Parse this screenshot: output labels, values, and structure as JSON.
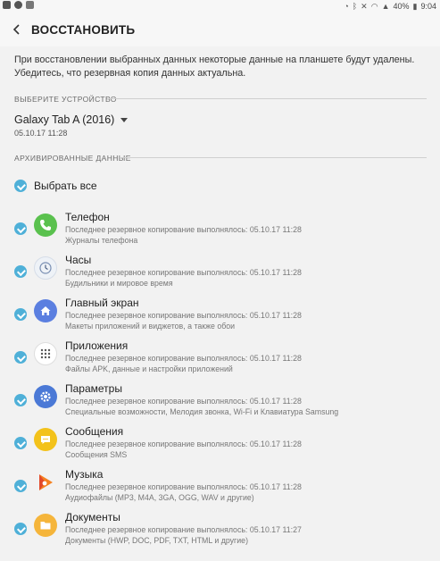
{
  "status": {
    "left_icons": [
      "mail-icon",
      "app-icon",
      "download-icon"
    ],
    "battery": "40%",
    "time": "9:04",
    "right_icons": [
      "sync-icon",
      "bluetooth-icon",
      "mute-icon",
      "wifi-icon",
      "signal-icon",
      "battery-icon"
    ]
  },
  "header": {
    "title": "ВОССТАНОВИТЬ"
  },
  "notice": "При восстановлении выбранных данных некоторые данные на планшете будут удалены. Убедитесь, что резервная копия данных актуальна.",
  "device_section": {
    "heading": "ВЫБЕРИТЕ УСТРОЙСТВО",
    "device_name": "Galaxy Tab A (2016)",
    "device_date": "05.10.17 11:28"
  },
  "data_section": {
    "heading": "АРХИВИРОВАННЫЕ ДАННЫЕ",
    "select_all": "Выбрать все",
    "items": [
      {
        "name": "Телефон",
        "line1": "Последнее резервное копирование выполнялось: 05.10.17 11:28",
        "line2": "Журналы телефона",
        "icon": "phone-icon",
        "color": "#5ac14e"
      },
      {
        "name": "Часы",
        "line1": "Последнее резервное копирование выполнялось: 05.10.17 11:28",
        "line2": "Будильники и мировое время",
        "icon": "clock-icon",
        "color": "#eef2f7"
      },
      {
        "name": "Главный экран",
        "line1": "Последнее резервное копирование выполнялось: 05.10.17 11:28",
        "line2": "Макеты приложений и виджетов, а также обои",
        "icon": "home-icon",
        "color": "#5b7fe0"
      },
      {
        "name": "Приложения",
        "line1": "Последнее резервное копирование выполнялось: 05.10.17 11:28",
        "line2": "Файлы APK, данные и настройки приложений",
        "icon": "apps-icon",
        "color": "#ffffff"
      },
      {
        "name": "Параметры",
        "line1": "Последнее резервное копирование выполнялось: 05.10.17 11:28",
        "line2": "Специальные возможности, Мелодия звонка, Wi-Fi и Клавиатура Samsung",
        "icon": "settings-icon",
        "color": "#4b79d6"
      },
      {
        "name": "Сообщения",
        "line1": "Последнее резервное копирование выполнялось: 05.10.17 11:28",
        "line2": "Сообщения SMS",
        "icon": "messages-icon",
        "color": "#f3c21b"
      },
      {
        "name": "Музыка",
        "line1": "Последнее резервное копирование выполнялось: 05.10.17 11:28",
        "line2": "Аудиофайлы (MP3, M4A, 3GA, OGG, WAV и другие)",
        "icon": "music-icon",
        "color": "#f58220"
      },
      {
        "name": "Документы",
        "line1": "Последнее резервное копирование выполнялось: 05.10.17 11:27",
        "line2": "Документы (HWP, DOC, PDF, TXT, HTML и другие)",
        "icon": "documents-icon",
        "color": "#f5b53b"
      }
    ]
  },
  "colors": {
    "accent": "#4fb0d8",
    "background": "#f2f2f2"
  }
}
